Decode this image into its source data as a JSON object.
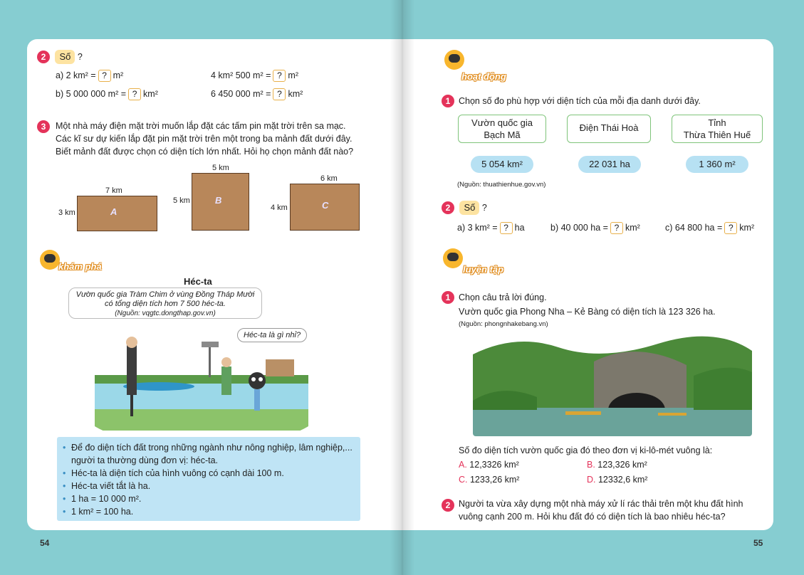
{
  "left": {
    "page_number": "54",
    "ex2": {
      "num": "2",
      "label": "Số",
      "q": "?",
      "a_pre": "a) 2 km² =",
      "a_post": "m²",
      "b_pre": "b) 5 000 000 m² =",
      "b_post": "km²",
      "c_pre": "4 km² 500 m² =",
      "c_post": "m²",
      "d_pre": "6 450 000 m² =",
      "d_post": "km²",
      "box": "?"
    },
    "ex3": {
      "num": "3",
      "line1": "Một nhà máy điện mặt trời muốn lắp đặt các tấm pin mặt trời trên sa mạc.",
      "line2": "Các kĩ sư dự kiến lắp đặt pin mặt trời trên một trong ba mảnh đất dưới đây.",
      "line3": "Biết mảnh đất được chọn có diện tích lớn nhất. Hỏi họ chọn mảnh đất nào?",
      "plots": [
        {
          "letter": "A",
          "width_label": "7 km",
          "height_label": "3 km"
        },
        {
          "letter": "B",
          "width_label": "5 km",
          "height_label": "5 km"
        },
        {
          "letter": "C",
          "width_label": "6 km",
          "height_label": "4 km"
        }
      ]
    },
    "explore": {
      "title": "khám phá",
      "heading": "Héc-ta",
      "quote1": "Vườn quốc gia Tràm Chim ở vùng Đồng Tháp Mười",
      "quote2": "có tổng diện tích hơn 7 500 héc-ta.",
      "source": "(Nguồn: vqgtc.dongthap.gov.vn)",
      "speech": "Héc-ta là gì nhỉ?",
      "bullets": [
        "Để đo diện tích đất trong những ngành như nông nghiệp, lâm nghiệp,...",
        "người ta thường dùng đơn vị: héc-ta.",
        "Héc-ta là diện tích của hình vuông có cạnh dài 100 m.",
        "Héc-ta viết tắt là ha.",
        "1 ha = 10 000 m².",
        "1 km² = 100 ha."
      ]
    }
  },
  "right": {
    "page_number": "55",
    "activity": {
      "title": "hoạt động",
      "ex1": {
        "num": "1",
        "text": "Chọn số đo phù hợp với diện tích của mỗi địa danh dưới đây.",
        "places": [
          {
            "l1": "Vườn quốc gia",
            "l2": "Bạch Mã"
          },
          {
            "l1": "Điện Thái Hoà",
            "l2": ""
          },
          {
            "l1": "Tỉnh",
            "l2": "Thừa Thiên Huế"
          }
        ],
        "areas": [
          "5 054 km²",
          "22 031 ha",
          "1 360 m²"
        ],
        "source": "(Nguồn: thuathienhue.gov.vn)"
      },
      "ex2": {
        "num": "2",
        "label": "Số",
        "q": "?",
        "a_pre": "a) 3 km² =",
        "a_post": "ha",
        "b_pre": "b) 40 000 ha =",
        "b_post": "km²",
        "c_pre": "c) 64 800 ha =",
        "c_post": "km²",
        "box": "?"
      }
    },
    "practice": {
      "title": "luyện tập",
      "ex1": {
        "num": "1",
        "text": "Chọn câu trả lời đúng.",
        "fact": "Vườn quốc gia Phong Nha – Kẻ Bàng có diện tích là 123 326 ha.",
        "source": "(Nguồn: phongnhakebang.vn)",
        "question": "Số đo diện tích vườn quốc gia đó theo đơn vị ki-lô-mét vuông là:",
        "options": [
          {
            "key": "A.",
            "val": "12,3326 km²"
          },
          {
            "key": "B.",
            "val": "123,326 km²"
          },
          {
            "key": "C.",
            "val": "1233,26 km²"
          },
          {
            "key": "D.",
            "val": "12332,6 km²"
          }
        ]
      },
      "ex2": {
        "num": "2",
        "line1": "Người ta vừa xây dựng một nhà máy xử lí rác thải trên một khu đất hình",
        "line2": "vuông cạnh 200 m. Hỏi khu đất đó có diện tích là bao nhiêu héc-ta?"
      }
    }
  }
}
